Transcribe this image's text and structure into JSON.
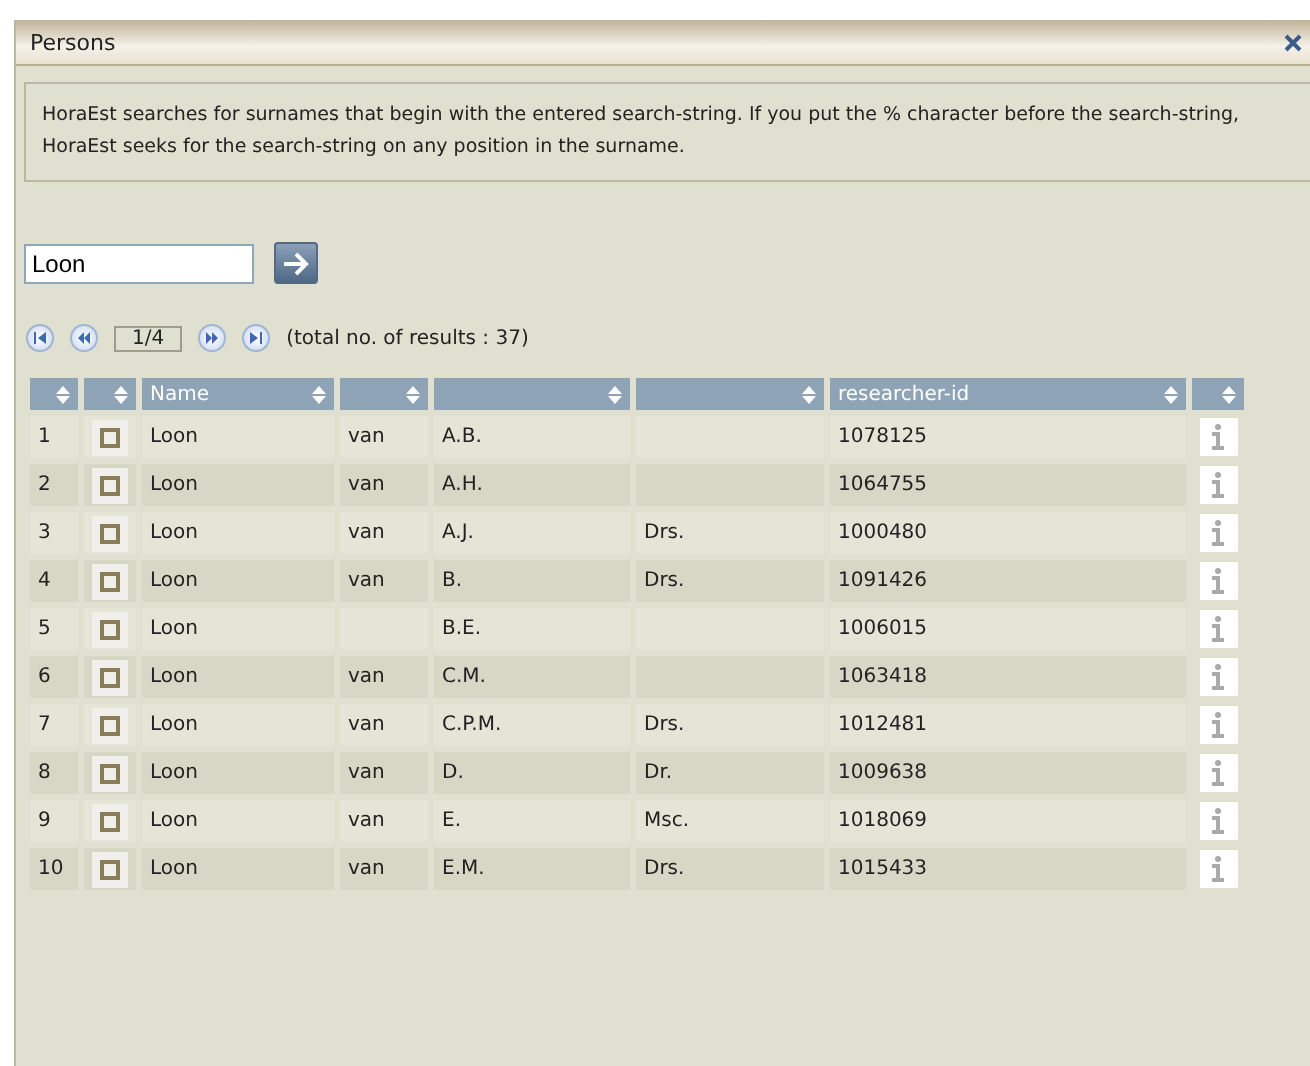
{
  "window": {
    "title": "Persons"
  },
  "info_text": "HoraEst searches for surnames that begin with the entered search-string. If you put the % character before the search-string, HoraEst seeks for the search-string on any position in the surname.",
  "search": {
    "value": "Loon"
  },
  "pager": {
    "page": "1/4",
    "total": "(total no. of results : 37)"
  },
  "table": {
    "columns": [
      "",
      "",
      "Name",
      "",
      "",
      "",
      "researcher-id",
      ""
    ],
    "rows": [
      {
        "number": "1",
        "checked": false,
        "name": "Loon",
        "prefix": "van",
        "initials": "A.B.",
        "title": "",
        "id": "1078125"
      },
      {
        "number": "2",
        "checked": false,
        "name": "Loon",
        "prefix": "van",
        "initials": "A.H.",
        "title": "",
        "id": "1064755"
      },
      {
        "number": "3",
        "checked": false,
        "name": "Loon",
        "prefix": "van",
        "initials": "A.J.",
        "title": "Drs.",
        "id": "1000480"
      },
      {
        "number": "4",
        "checked": false,
        "name": "Loon",
        "prefix": "van",
        "initials": "B.",
        "title": "Drs.",
        "id": "1091426"
      },
      {
        "number": "5",
        "checked": false,
        "name": "Loon",
        "prefix": "",
        "initials": "B.E.",
        "title": "",
        "id": "1006015"
      },
      {
        "number": "6",
        "checked": false,
        "name": "Loon",
        "prefix": "van",
        "initials": "C.M.",
        "title": "",
        "id": "1063418"
      },
      {
        "number": "7",
        "checked": false,
        "name": "Loon",
        "prefix": "van",
        "initials": "C.P.M.",
        "title": "Drs.",
        "id": "1012481"
      },
      {
        "number": "8",
        "checked": false,
        "name": "Loon",
        "prefix": "van",
        "initials": "D.",
        "title": "Dr.",
        "id": "1009638"
      },
      {
        "number": "9",
        "checked": false,
        "name": "Loon",
        "prefix": "van",
        "initials": "E.",
        "title": "Msc.",
        "id": "1018069"
      },
      {
        "number": "10",
        "checked": false,
        "name": "Loon",
        "prefix": "van",
        "initials": "E.M.",
        "title": "Drs.",
        "id": "1015433"
      }
    ]
  }
}
